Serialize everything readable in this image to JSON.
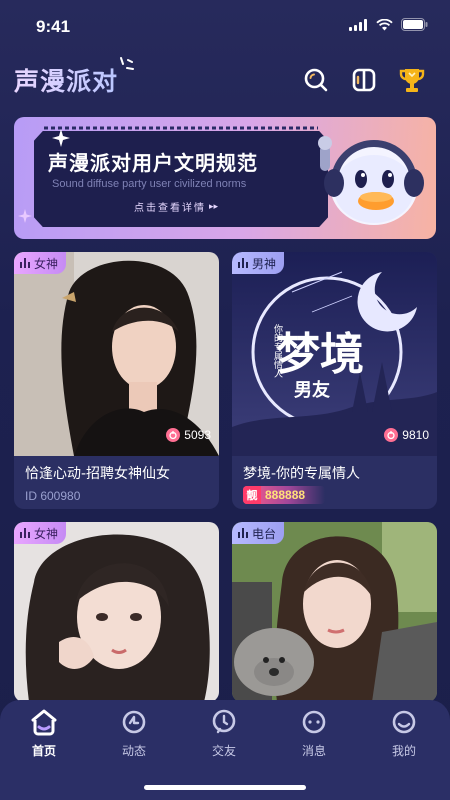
{
  "status_bar": {
    "time": "9:41"
  },
  "header": {
    "title": "声漫派对",
    "icons": [
      "search-icon",
      "switch-icon",
      "trophy-icon"
    ]
  },
  "banner": {
    "title": "声漫派对用户文明规范",
    "subtitle": "Sound diffuse party user civilized norms",
    "link_text": "点击查看详情",
    "colors": {
      "start": "#b79cf6",
      "end": "#f7b3a3",
      "panel": "#1e1f4e"
    }
  },
  "cards": [
    {
      "tag": "女神",
      "tag_color": "#d99bff",
      "count": "5093",
      "name": "恰逢心动-招聘女神仙女",
      "id_text": "ID 600980"
    },
    {
      "tag": "男神",
      "tag_color": "#a9abf9",
      "count": "9810",
      "name": "梦境-你的专属情人",
      "badge_mark": "靓",
      "badge_number": "888888",
      "image_text": {
        "main": "梦境",
        "sub": "男友",
        "side": "你的专属情人"
      }
    },
    {
      "tag": "女神",
      "tag_color": "#d99bff"
    },
    {
      "tag": "电台",
      "tag_color": "#a9abf9"
    }
  ],
  "tabs": [
    {
      "label": "首页",
      "icon": "home-icon",
      "active": true
    },
    {
      "label": "动态",
      "icon": "moments-icon",
      "active": false
    },
    {
      "label": "交友",
      "icon": "friends-icon",
      "active": false
    },
    {
      "label": "消息",
      "icon": "message-icon",
      "active": false
    },
    {
      "label": "我的",
      "icon": "profile-icon",
      "active": false
    }
  ]
}
